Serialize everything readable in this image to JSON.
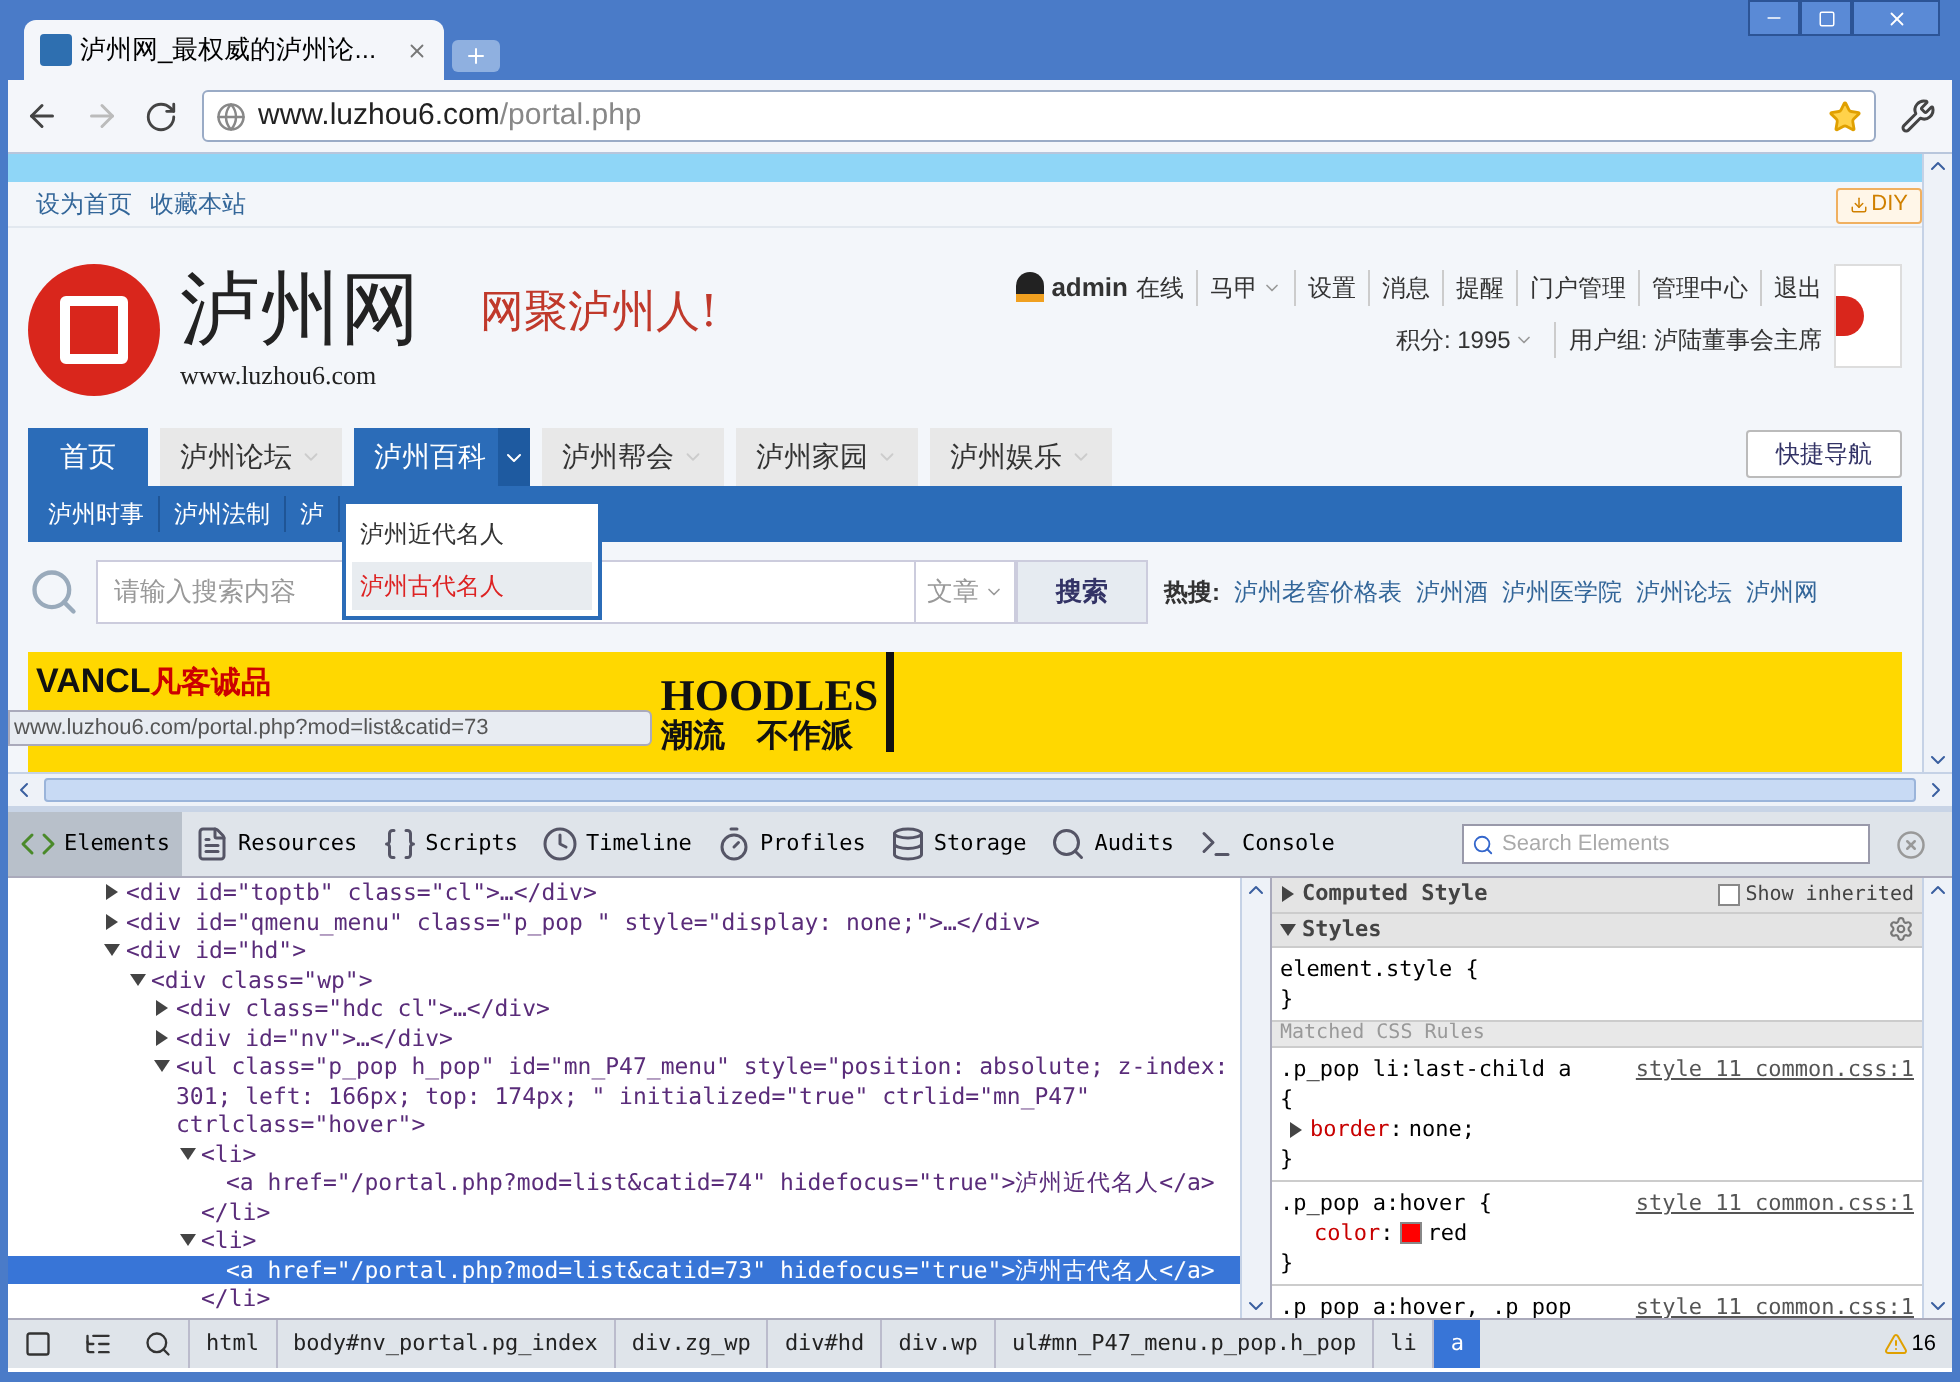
{
  "browser": {
    "tab_title": "泸州网_最权威的泸州论...",
    "address_domain": "www.luzhou6.com",
    "address_path": "/portal.php"
  },
  "page": {
    "top_links": [
      "设为首页",
      "收藏本站"
    ],
    "diy_button": "DIY",
    "logo": {
      "name": "泸州网",
      "url": "www.luzhou6.com",
      "slogan": "网聚泸州人!"
    },
    "user": {
      "name": "admin",
      "status": "在线",
      "links": [
        {
          "label": "马甲",
          "dropdown": true
        },
        {
          "label": "设置",
          "dropdown": false
        },
        {
          "label": "消息",
          "dropdown": false
        },
        {
          "label": "提醒",
          "dropdown": false
        },
        {
          "label": "门户管理",
          "dropdown": false
        },
        {
          "label": "管理中心",
          "dropdown": false
        },
        {
          "label": "退出",
          "dropdown": false
        }
      ],
      "credits": "积分: 1995",
      "group": "用户组: 泸陆董事会主席"
    },
    "nav": [
      {
        "label": "首页",
        "selected": true,
        "open": false
      },
      {
        "label": "泸州论坛",
        "selected": false,
        "open": false
      },
      {
        "label": "泸州百科",
        "selected": false,
        "open": true
      },
      {
        "label": "泸州帮会",
        "selected": false,
        "open": false
      },
      {
        "label": "泸州家园",
        "selected": false,
        "open": false
      },
      {
        "label": "泸州娱乐",
        "selected": false,
        "open": false
      }
    ],
    "quick_nav": "快捷导航",
    "subnav": [
      "泸州时事",
      "泸州法制",
      "泸"
    ],
    "dropdown": [
      {
        "label": "泸州近代名人",
        "selected": false
      },
      {
        "label": "泸州古代名人",
        "selected": true
      }
    ],
    "search": {
      "placeholder": "请输入搜索内容",
      "type": "文章",
      "button": "搜索",
      "hot_label": "热搜:",
      "hot": [
        "泸州老窖价格表",
        "泸州酒",
        "泸州医学院",
        "泸州论坛",
        "泸州网"
      ]
    },
    "banner": {
      "brand": "VANCL",
      "brand_cn": "凡客诚品",
      "headline": "HOODLES",
      "tagline": "潮流　不作派"
    },
    "status_url": "www.luzhou6.com/portal.php?mod=list&catid=73"
  },
  "devtools": {
    "tabs": [
      {
        "label": "Elements",
        "selected": true
      },
      {
        "label": "Resources",
        "selected": false
      },
      {
        "label": "Scripts",
        "selected": false
      },
      {
        "label": "Timeline",
        "selected": false
      },
      {
        "label": "Profiles",
        "selected": false
      },
      {
        "label": "Storage",
        "selected": false
      },
      {
        "label": "Audits",
        "selected": false
      },
      {
        "label": "Console",
        "selected": false
      }
    ],
    "search_placeholder": "Search Elements",
    "dom": [
      {
        "text": "<div id=\"toptb\" class=\"cl\">…</div>",
        "expanded": false,
        "selected": false
      },
      {
        "text": "<div id=\"qmenu_menu\" class=\"p_pop \" style=\"display: none;\">…</div>",
        "expanded": false,
        "selected": false
      },
      {
        "text": "<div id=\"hd\">",
        "expanded": true,
        "selected": false,
        "children": [
          {
            "text": "<div class=\"wp\">",
            "expanded": true,
            "selected": false,
            "children": [
              {
                "text": "<div class=\"hdc cl\">…</div>",
                "expanded": false,
                "selected": false
              },
              {
                "text": "<div id=\"nv\">…</div>",
                "expanded": false,
                "selected": false
              },
              {
                "text": "<ul class=\"p_pop h_pop\" id=\"mn_P47_menu\" style=\"position: absolute; z-index: 301; left: 166px; top: 174px; \" initialized=\"true\" ctrlid=\"mn_P47\" ctrlclass=\"hover\">",
                "expanded": true,
                "selected": false,
                "children": [
                  {
                    "text": "<li>",
                    "expanded": true,
                    "selected": false,
                    "close": "</li>",
                    "children": [
                      {
                        "text": "<a href=\"/portal.php?mod=list&catid=74\" hidefocus=\"true\">泸州近代名人</a>",
                        "selected": false
                      }
                    ]
                  },
                  {
                    "text": "<li>",
                    "expanded": true,
                    "selected": false,
                    "close": "</li>",
                    "children": [
                      {
                        "text": "<a href=\"/portal.php?mod=list&catid=73\" hidefocus=\"true\">泸州古代名人</a>",
                        "selected": true
                      }
                    ]
                  }
                ]
              }
            ]
          }
        ]
      }
    ],
    "computed": {
      "title": "Computed Style",
      "expanded": false,
      "show_inherited": "Show inherited",
      "checked": false
    },
    "styles": {
      "title": "Styles",
      "expanded": true,
      "element_style": "element.style {",
      "element_close": "}",
      "matched_label": "Matched CSS Rules",
      "rules": [
        {
          "selector": ".p_pop li:last-child a",
          "open": "{",
          "source": "style 11 common.css:1",
          "properties": [
            {
              "name": "border",
              "sep": ":",
              "value": "none;",
              "expandable": true,
              "swatch": false
            }
          ],
          "close": "}"
        },
        {
          "selector": ".p_pop a:hover {",
          "source": "style 11 common.css:1",
          "properties": [
            {
              "name": "color",
              "sep": ":",
              "value": "red",
              "expandable": false,
              "swatch": true
            }
          ],
          "close": "}"
        },
        {
          "selector": ".p_pop a:hover, .p_pop",
          "source": "style 11 common.css:1"
        }
      ]
    },
    "breadcrumbs": [
      {
        "label": "html",
        "selected": false
      },
      {
        "label": "body#nv_portal.pg_index",
        "selected": false
      },
      {
        "label": "div.zg_wp",
        "selected": false
      },
      {
        "label": "div#hd",
        "selected": false
      },
      {
        "label": "div.wp",
        "selected": false
      },
      {
        "label": "ul#mn_P47_menu.p_pop.h_pop",
        "selected": false
      },
      {
        "label": "li",
        "selected": false
      },
      {
        "label": "a",
        "selected": true
      }
    ],
    "warnings": "16"
  }
}
